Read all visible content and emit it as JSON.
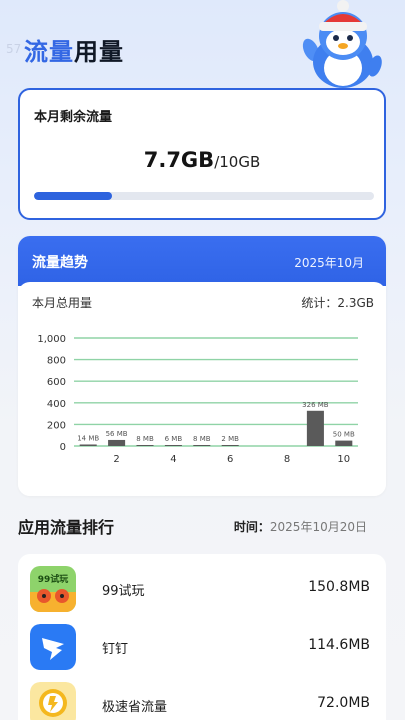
{
  "status": {
    "time": "57"
  },
  "header": {
    "title_accent": "流量",
    "title_rest": "用量"
  },
  "remaining": {
    "label": "本月剩余流量",
    "value": "7.7GB",
    "total": "/10GB",
    "progress": 0.23
  },
  "trend": {
    "title": "流量趋势",
    "month": "2025年10月",
    "total_label": "本月总用量",
    "stat_text": "统计：2.3GB"
  },
  "chart_data": {
    "type": "bar",
    "x": [
      1,
      2,
      3,
      4,
      5,
      6,
      7,
      8,
      9,
      10
    ],
    "values": [
      14,
      56,
      8,
      6,
      8,
      2,
      0,
      0,
      326,
      50
    ],
    "data_labels": [
      "14 MB",
      "56 MB",
      "8 MB",
      "6 MB",
      "8 MB",
      "2 MB",
      "",
      "",
      "326 MB",
      "50 MB"
    ],
    "x_ticks": [
      "2",
      "4",
      "6",
      "8",
      "10"
    ],
    "x_tick_values": [
      2,
      4,
      6,
      8,
      10
    ],
    "y_ticks": [
      "0",
      "200",
      "400",
      "600",
      "800",
      "1,000"
    ],
    "ylim": [
      0,
      1000
    ],
    "xlim": [
      0.5,
      10.5
    ],
    "grid": true,
    "bar_color": "#5a5a5a",
    "grid_color": "#8fd3a6"
  },
  "ranking": {
    "title": "应用流量排行",
    "time_label": "时间：",
    "time_value": "2025年10月20日",
    "apps": [
      {
        "name": "99试玩",
        "usage": "150.8MB",
        "icon": "99-shiwan-icon",
        "icon_text": "99试玩"
      },
      {
        "name": "钉钉",
        "usage": "114.6MB",
        "icon": "dingtalk-icon"
      },
      {
        "name": "极速省流量",
        "usage": "72.0MB",
        "icon": "jisu-shengliuliang-icon"
      }
    ]
  },
  "colors": {
    "accent": "#2f63df",
    "header_blue": "#3367e4"
  }
}
